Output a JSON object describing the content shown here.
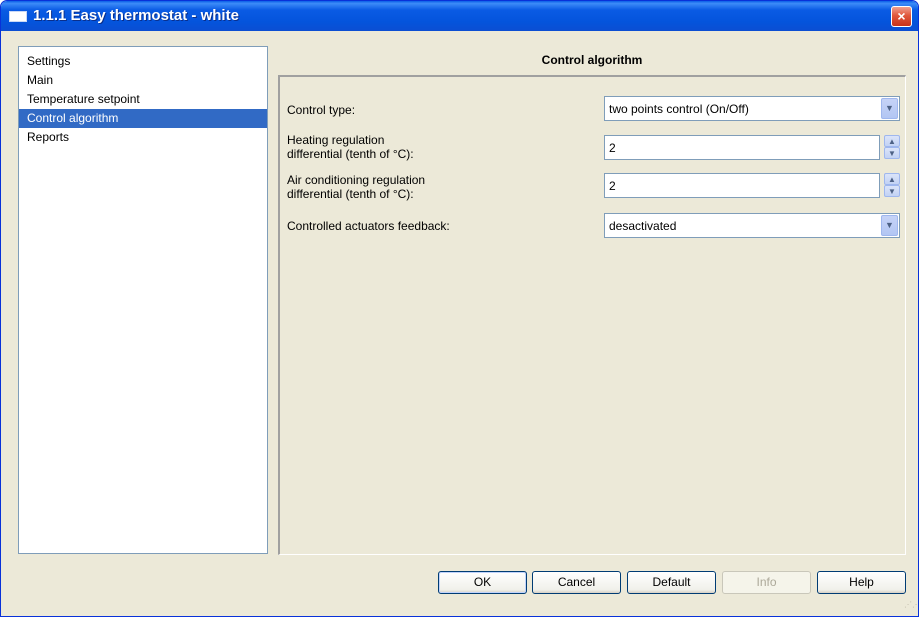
{
  "window": {
    "title": "1.1.1 Easy thermostat - white",
    "close_glyph": "×"
  },
  "tree": {
    "items": [
      {
        "label": "Settings",
        "selected": false
      },
      {
        "label": "Main",
        "selected": false
      },
      {
        "label": "Temperature setpoint",
        "selected": false
      },
      {
        "label": "Control algorithm",
        "selected": true
      },
      {
        "label": "Reports",
        "selected": false
      }
    ]
  },
  "panel": {
    "title": "Control algorithm",
    "control_type": {
      "label": "Control type:",
      "value": "two points control (On/Off)"
    },
    "heating": {
      "label_line1": "Heating regulation",
      "label_line2": "differential (tenth of °C):",
      "value": "2"
    },
    "air": {
      "label_line1": "Air conditioning regulation",
      "label_line2": "differential (tenth of °C):",
      "value": "2"
    },
    "feedback": {
      "label": "Controlled actuators feedback:",
      "value": "desactivated"
    }
  },
  "buttons": {
    "ok": "OK",
    "cancel": "Cancel",
    "default": "Default",
    "info": "Info",
    "help": "Help"
  },
  "icons": {
    "close": "close-icon",
    "dropdown": "chevron-down-icon",
    "spin_up": "spin-up-icon",
    "spin_down": "spin-down-icon"
  }
}
